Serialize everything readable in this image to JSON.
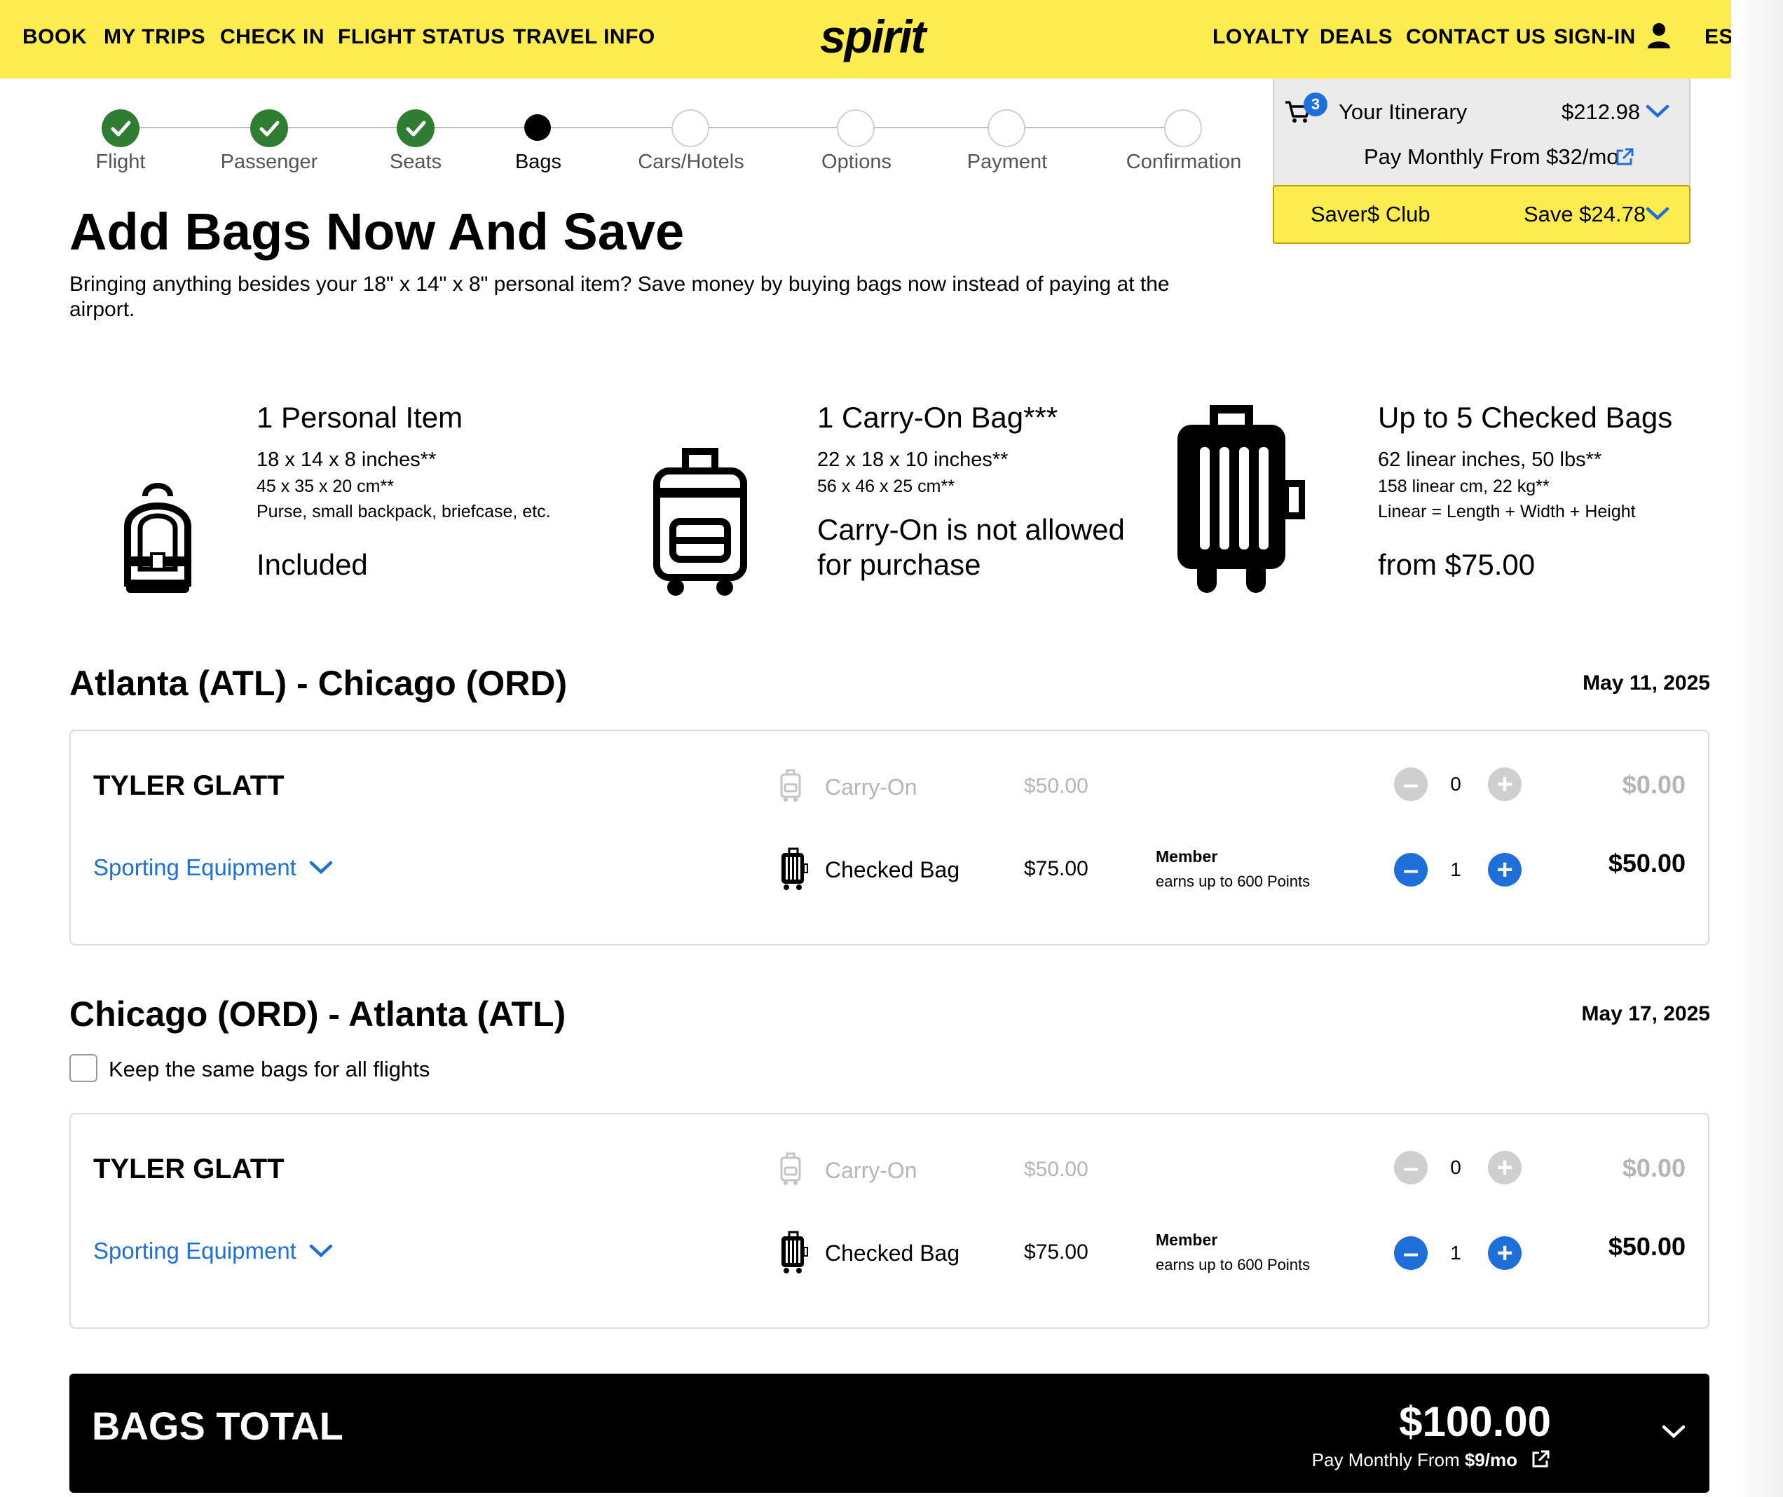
{
  "nav": {
    "left": [
      "BOOK",
      "MY TRIPS",
      "CHECK IN",
      "FLIGHT STATUS",
      "TRAVEL INFO"
    ],
    "logo": "spirit",
    "right": [
      "LOYALTY",
      "DEALS",
      "CONTACT US",
      "SIGN-IN"
    ],
    "lang": "ES"
  },
  "progress": {
    "steps": [
      "Flight",
      "Passenger",
      "Seats",
      "Bags",
      "Cars/Hotels",
      "Options",
      "Payment",
      "Confirmation"
    ],
    "current_index": 3
  },
  "itinerary": {
    "badge": "3",
    "label": "Your Itinerary",
    "amount": "$212.98",
    "pay_monthly": "Pay Monthly From $32/mo",
    "saver_label": "Saver$ Club",
    "saver_save": "Save $24.78"
  },
  "page": {
    "title": "Add Bags Now And Save",
    "intro": "Bringing anything besides your 18\" x 14\" x 8\" personal item? Save money by buying bags now instead of paying at the airport."
  },
  "bag_types": [
    {
      "icon": "backpack-icon",
      "title": "1 Personal Item",
      "dim1": "18 x 14 x 8 inches**",
      "dim2": "45 x 35 x 20 cm**",
      "note": "Purse, small backpack, briefcase, etc.",
      "status": "Included"
    },
    {
      "icon": "carry-on-icon",
      "title": "1 Carry-On Bag***",
      "dim1": "22 x 18 x 10 inches**",
      "dim2": "56 x 46 x 25 cm**",
      "status_line1": "Carry-On is not allowed",
      "status_line2": "for purchase"
    },
    {
      "icon": "checked-bag-icon",
      "title": "Up to 5 Checked Bags",
      "dim1": "62 linear inches, 50 lbs**",
      "dim2": "158 linear cm, 22 kg**",
      "note": "Linear = Length + Width + Height",
      "status": "from $75.00"
    }
  ],
  "flights": [
    {
      "route": "Atlanta (ATL) - Chicago (ORD)",
      "date": "May 11, 2025",
      "passenger": "TYLER GLATT",
      "sporting": "Sporting Equipment",
      "carry_on": {
        "label": "Carry-On",
        "price": "$50.00",
        "qty": "0",
        "total": "$0.00"
      },
      "checked": {
        "label": "Checked Bag",
        "price": "$75.00",
        "member": "Member",
        "earn": "earns up to 600 Points",
        "qty": "1",
        "total": "$50.00"
      }
    },
    {
      "route": "Chicago (ORD) - Atlanta (ATL)",
      "date": "May 17, 2025",
      "keep_same": "Keep the same bags for all flights",
      "passenger": "TYLER GLATT",
      "sporting": "Sporting Equipment",
      "carry_on": {
        "label": "Carry-On",
        "price": "$50.00",
        "qty": "0",
        "total": "$0.00"
      },
      "checked": {
        "label": "Checked Bag",
        "price": "$75.00",
        "member": "Member",
        "earn": "earns up to 600 Points",
        "qty": "1",
        "total": "$50.00"
      }
    }
  ],
  "bags_total": {
    "label": "BAGS TOTAL",
    "amount": "$100.00",
    "pay_monthly_prefix": "Pay Monthly From ",
    "pay_monthly_amount": "$9/mo"
  },
  "colors": {
    "brand_yellow": "#fcec4f",
    "accent_blue": "#1e6fd9",
    "success_green": "#2e7d32"
  }
}
